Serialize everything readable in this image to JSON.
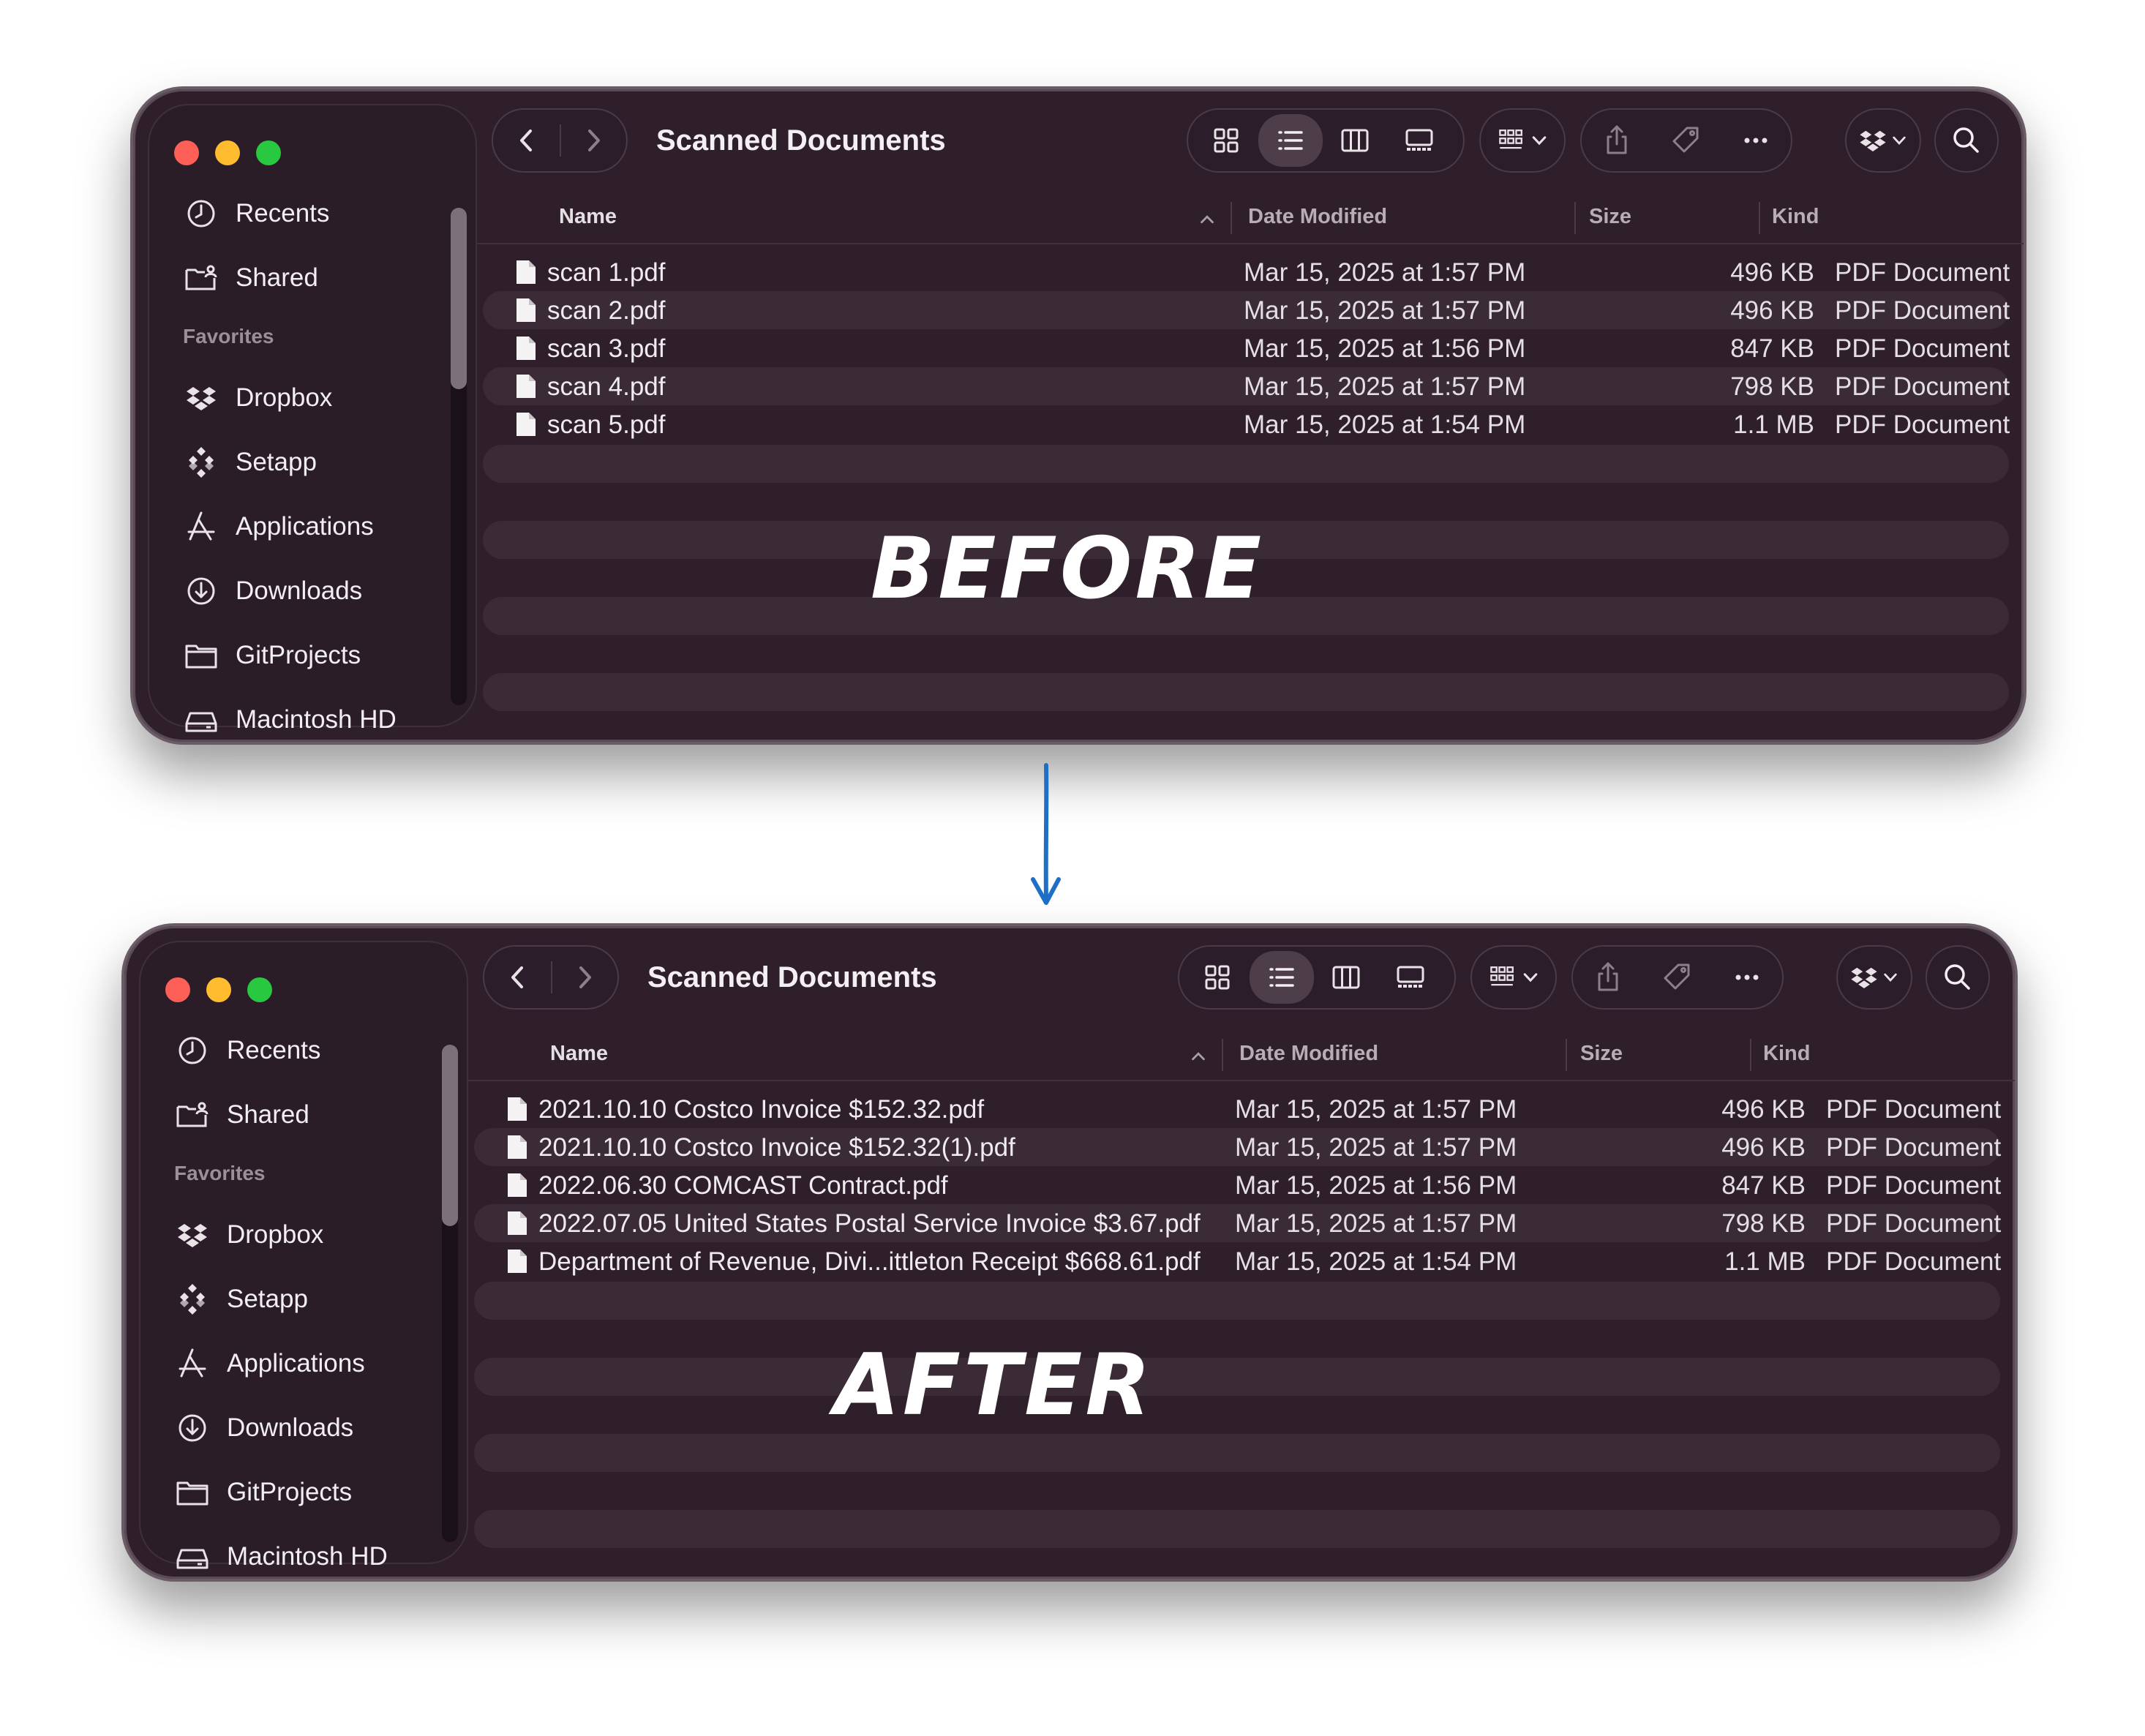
{
  "before": {
    "label": "BEFORE",
    "window": {
      "title": "Scanned Documents",
      "sidebar": {
        "items_top": [
          {
            "label": "Recents",
            "icon": "clock-icon"
          },
          {
            "label": "Shared",
            "icon": "shared-folder-icon"
          }
        ],
        "favorites_heading": "Favorites",
        "favorites": [
          {
            "label": "Dropbox",
            "icon": "dropbox-icon"
          },
          {
            "label": "Setapp",
            "icon": "setapp-icon"
          },
          {
            "label": "Applications",
            "icon": "applications-icon"
          },
          {
            "label": "Downloads",
            "icon": "download-icon"
          },
          {
            "label": "GitProjects",
            "icon": "folder-icon"
          },
          {
            "label": "Macintosh HD",
            "icon": "disk-icon"
          }
        ]
      },
      "columns": {
        "name": "Name",
        "date": "Date Modified",
        "size": "Size",
        "kind": "Kind"
      },
      "files": [
        {
          "name": "scan 1.pdf",
          "date": "Mar 15, 2025 at 1:57 PM",
          "size": "496 KB",
          "kind": "PDF Document"
        },
        {
          "name": "scan 2.pdf",
          "date": "Mar 15, 2025 at 1:57 PM",
          "size": "496 KB",
          "kind": "PDF Document"
        },
        {
          "name": "scan 3.pdf",
          "date": "Mar 15, 2025 at 1:56 PM",
          "size": "847 KB",
          "kind": "PDF Document"
        },
        {
          "name": "scan 4.pdf",
          "date": "Mar 15, 2025 at 1:57 PM",
          "size": "798 KB",
          "kind": "PDF Document"
        },
        {
          "name": "scan 5.pdf",
          "date": "Mar 15, 2025 at 1:54 PM",
          "size": "1.1 MB",
          "kind": "PDF Document"
        }
      ]
    }
  },
  "after": {
    "label": "AFTER",
    "window": {
      "title": "Scanned Documents",
      "sidebar": {
        "items_top": [
          {
            "label": "Recents",
            "icon": "clock-icon"
          },
          {
            "label": "Shared",
            "icon": "shared-folder-icon"
          }
        ],
        "favorites_heading": "Favorites",
        "favorites": [
          {
            "label": "Dropbox",
            "icon": "dropbox-icon"
          },
          {
            "label": "Setapp",
            "icon": "setapp-icon"
          },
          {
            "label": "Applications",
            "icon": "applications-icon"
          },
          {
            "label": "Downloads",
            "icon": "download-icon"
          },
          {
            "label": "GitProjects",
            "icon": "folder-icon"
          },
          {
            "label": "Macintosh HD",
            "icon": "disk-icon"
          }
        ]
      },
      "columns": {
        "name": "Name",
        "date": "Date Modified",
        "size": "Size",
        "kind": "Kind"
      },
      "files": [
        {
          "name": "2021.10.10 Costco Invoice $152.32.pdf",
          "date": "Mar 15, 2025 at 1:57 PM",
          "size": "496 KB",
          "kind": "PDF Document"
        },
        {
          "name": "2021.10.10 Costco Invoice $152.32(1).pdf",
          "date": "Mar 15, 2025 at 1:57 PM",
          "size": "496 KB",
          "kind": "PDF Document"
        },
        {
          "name": "2022.06.30 COMCAST Contract.pdf",
          "date": "Mar 15, 2025 at 1:56 PM",
          "size": "847 KB",
          "kind": "PDF Document"
        },
        {
          "name": "2022.07.05 United States Postal Service Invoice $3.67.pdf",
          "date": "Mar 15, 2025 at 1:57 PM",
          "size": "798 KB",
          "kind": "PDF Document"
        },
        {
          "name": "Department of Revenue, Divi...ittleton Receipt $668.61.pdf",
          "date": "Mar 15, 2025 at 1:54 PM",
          "size": "1.1 MB",
          "kind": "PDF Document"
        }
      ]
    }
  },
  "colors": {
    "window_bg": "#2e1f2b",
    "arrow": "#1f6fc6",
    "close": "#fe5f57",
    "minimize": "#febc2e",
    "zoom": "#28c840"
  }
}
